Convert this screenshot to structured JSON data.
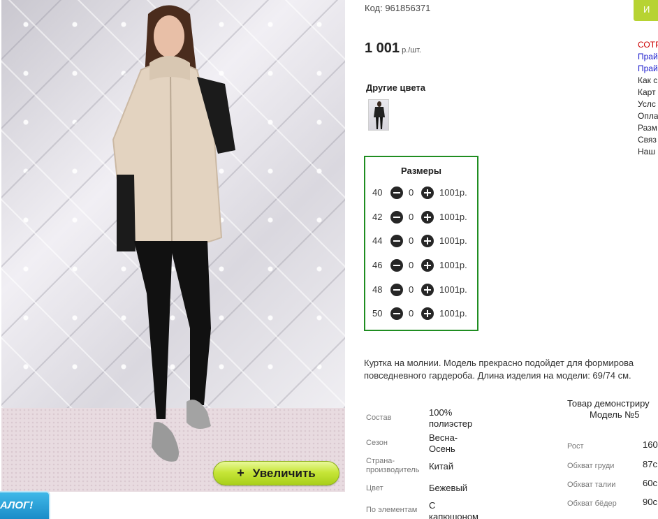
{
  "product": {
    "code_text": "Код: 961856371",
    "price_amount": "1 001",
    "price_unit": "р./шт."
  },
  "gallery": {
    "zoom_label": "Увеличить",
    "zoom_plus": "+",
    "catalog_badge": "АЛОГ!"
  },
  "other_colors": {
    "title": "Другие цвета"
  },
  "sizes": {
    "title": "Размеры",
    "rows": [
      {
        "size": "40",
        "qty": "0",
        "price": "1001р."
      },
      {
        "size": "42",
        "qty": "0",
        "price": "1001р."
      },
      {
        "size": "44",
        "qty": "0",
        "price": "1001р."
      },
      {
        "size": "46",
        "qty": "0",
        "price": "1001р."
      },
      {
        "size": "48",
        "qty": "0",
        "price": "1001р."
      },
      {
        "size": "50",
        "qty": "0",
        "price": "1001р."
      }
    ]
  },
  "description": {
    "line1": "Куртка на молнии. Модель прекрасно подойдет для формирова",
    "line2": "повседневного гардероба. Длина изделия на модели: 69/74 см."
  },
  "specs": [
    {
      "label": "Состав",
      "value": "100% полиэстер"
    },
    {
      "label": "Сезон",
      "value": "Весна-Осень"
    },
    {
      "label": "Страна-производитель",
      "value": "Китай"
    },
    {
      "label": "Цвет",
      "value": "Бежевый"
    },
    {
      "label": "По элементам",
      "value": "С капюшоном"
    }
  ],
  "model_info": {
    "title": "Товар демонстриру",
    "model": "Модель №5",
    "measurements": [
      {
        "label": "Рост",
        "value": "160с"
      },
      {
        "label": "Обхват груди",
        "value": "87с"
      },
      {
        "label": "Обхват талии",
        "value": "60с"
      },
      {
        "label": "Обхват бёдер",
        "value": "90с"
      }
    ]
  },
  "side": {
    "buy_label": "И",
    "links": [
      "СОТР",
      "Прай",
      "Прай",
      "Как с",
      "Карт",
      "Услс",
      "Опла",
      "Разм",
      "Связ",
      "Наш"
    ],
    "link_colors": [
      "#cc0000",
      "#1a1acc",
      "#1a1acc",
      "#222222",
      "#222222",
      "#222222",
      "#222222",
      "#222222",
      "#222222",
      "#222222"
    ]
  },
  "colors": {
    "accent_green": "#1f8d21",
    "zoom_button": "#c7e639"
  }
}
